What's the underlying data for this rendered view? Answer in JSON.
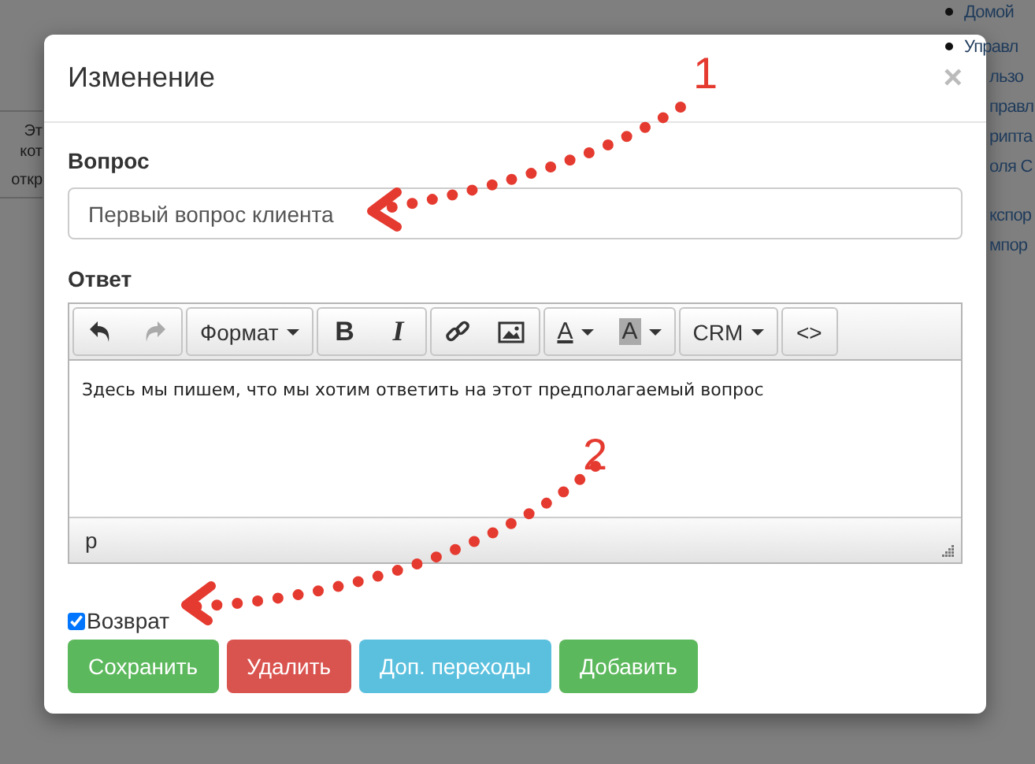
{
  "background_page": {
    "left_fragments": [
      "Эт",
      "кот",
      "откр"
    ],
    "right_menu": [
      {
        "label": "Домой",
        "bullet": true
      },
      {
        "label": "Управл",
        "bullet": true
      },
      {
        "label": "льзо",
        "bullet": false
      },
      {
        "label": "правл",
        "bullet": false
      },
      {
        "label": "рипта",
        "bullet": false
      },
      {
        "label": "оля С",
        "bullet": false
      },
      {
        "label": "кспор",
        "bullet": false
      },
      {
        "label": "мпор",
        "bullet": false
      }
    ]
  },
  "dialog": {
    "title": "Изменение",
    "close": "×",
    "question": {
      "label": "Вопрос",
      "value": "Первый вопрос клиента"
    },
    "answer": {
      "label": "Ответ",
      "toolbar": [
        [
          {
            "kind": "undo",
            "disabled": false
          },
          {
            "kind": "redo",
            "disabled": true
          }
        ],
        [
          {
            "kind": "dropdown",
            "text": "Формат",
            "disabled": false
          }
        ],
        [
          {
            "kind": "bold",
            "text": "B",
            "disabled": false
          },
          {
            "kind": "italic",
            "text": "I",
            "disabled": false
          }
        ],
        [
          {
            "kind": "link",
            "disabled": false
          },
          {
            "kind": "image",
            "disabled": false
          }
        ],
        [
          {
            "kind": "textcolor",
            "text": "A",
            "disabled": false
          },
          {
            "kind": "bgcolor",
            "text": "A",
            "disabled": false
          }
        ],
        [
          {
            "kind": "dropdown",
            "text": "CRM",
            "disabled": false
          }
        ],
        [
          {
            "kind": "code",
            "text": "<>",
            "disabled": false
          }
        ]
      ],
      "content": "Здесь мы пишем, что мы хотим ответить на этот предполагаемый вопрос",
      "path": "p"
    },
    "return_checkbox": {
      "label": "Возврат",
      "checked": true
    },
    "buttons": [
      {
        "label": "Сохранить",
        "color": "#5cb85c"
      },
      {
        "label": "Удалить",
        "color": "#d9534f"
      },
      {
        "label": "Доп. переходы",
        "color": "#5bc0de"
      },
      {
        "label": "Добавить",
        "color": "#5cb85c"
      }
    ]
  },
  "annotations": [
    {
      "number": "1"
    },
    {
      "number": "2"
    }
  ]
}
